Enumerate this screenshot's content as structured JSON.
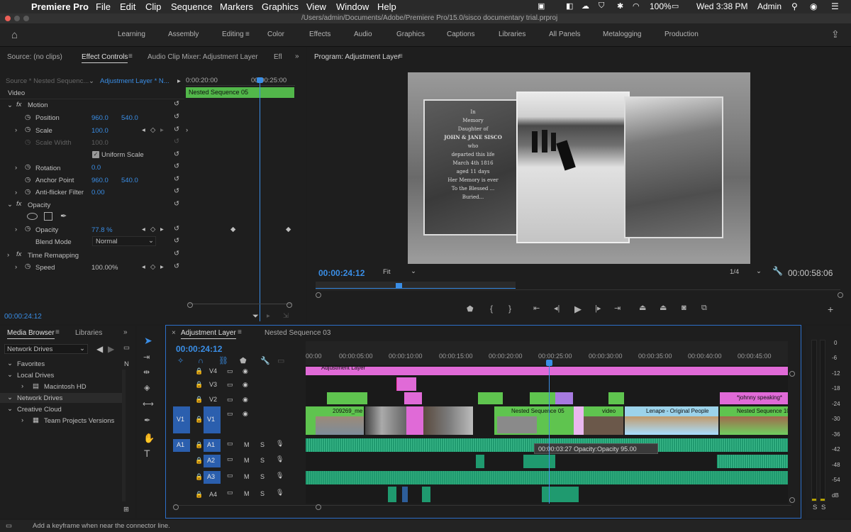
{
  "menubar": {
    "app": "Premiere Pro",
    "items": [
      "File",
      "Edit",
      "Clip",
      "Sequence",
      "Markers",
      "Graphics",
      "View",
      "Window",
      "Help"
    ],
    "battery": "100%",
    "datetime": "Wed 3:38 PM",
    "user": "Admin"
  },
  "window": {
    "title": "/Users/admin/Documents/Adobe/Premiere Pro/15.0/sisco documentary trial.prproj"
  },
  "workspaces": {
    "items": [
      "Learning",
      "Assembly",
      "Editing",
      "Color",
      "Effects",
      "Audio",
      "Graphics",
      "Captions",
      "Libraries",
      "All Panels",
      "Metalogging",
      "Production"
    ],
    "active": "Editing"
  },
  "source_panel": {
    "tabs": [
      "Source: (no clips)",
      "Effect Controls",
      "Audio Clip Mixer: Adjustment Layer",
      "Efl"
    ],
    "source_select": "Source * Nested Sequenc...",
    "target_select": "Adjustment Layer * N...",
    "ruler_start": "0:00:20:00",
    "ruler_end": "00:00:25:00",
    "clip_name": "Nested Sequence 05",
    "section_video": "Video",
    "timecode": "00:00:24:12",
    "motion": {
      "label": "Motion",
      "position_label": "Position",
      "position_x": "960.0",
      "position_y": "540.0",
      "scale_label": "Scale",
      "scale": "100.0",
      "scale_width_label": "Scale Width",
      "scale_width": "100.0",
      "uniform_label": "Uniform Scale",
      "rotation_label": "Rotation",
      "rotation": "0.0",
      "anchor_label": "Anchor Point",
      "anchor_x": "960.0",
      "anchor_y": "540.0",
      "antiflicker_label": "Anti-flicker Filter",
      "antiflicker": "0.00"
    },
    "opacity": {
      "label": "Opacity",
      "opacity_label": "Opacity",
      "opacity": "77.8 %",
      "blend_label": "Blend Mode",
      "blend": "Normal"
    },
    "time_remap": {
      "label": "Time Remapping",
      "speed_label": "Speed",
      "speed": "100.00%"
    }
  },
  "program": {
    "title": "Program: Adjustment Layer",
    "timecode": "00:00:24:12",
    "fit": "Fit",
    "resolution": "1/4",
    "duration": "00:00:58:06",
    "photo_text": [
      "In",
      "Memory",
      "Daughter of",
      "JOHN & JANE SISCO",
      "who",
      "departed this life",
      "March 4th 1816",
      "aged 11 days",
      "Her Memory is ever",
      "To the Blessed ...",
      "Buried..."
    ]
  },
  "project": {
    "tabs": [
      "Media Browser",
      "Libraries"
    ],
    "location": "Network Drives",
    "tree": [
      "Favorites",
      "Local Drives",
      "Macintosh HD",
      "Network Drives",
      "Creative Cloud",
      "Team Projects Versions"
    ]
  },
  "timeline": {
    "tabs": [
      "Adjustment Layer",
      "Nested Sequence 03"
    ],
    "timecode": "00:00:24:12",
    "ruler": [
      "00:00",
      "00:00:05:00",
      "00:00:10:00",
      "00:00:15:00",
      "00:00:20:00",
      "00:00:25:00",
      "00:00:30:00",
      "00:00:35:00",
      "00:00:40:00",
      "00:00:45:00"
    ],
    "tracks": {
      "video": [
        "V4",
        "V3",
        "V2",
        "V1"
      ],
      "audio": [
        "A1",
        "A2",
        "A3",
        "A4"
      ]
    },
    "clip_labels": {
      "adjustment": "Adjustment Layer",
      "johnny": "*johnny speaking*",
      "c209": "209269_me",
      "nested05": "Nested Sequence 05",
      "video": "video",
      "lenape": "Lenape - Original People",
      "nested10": "Nested Sequence 10"
    },
    "tooltip": "00:00:03:27  Opacity:Opacity  95.00"
  },
  "meter": {
    "scale": [
      "0",
      "-6",
      "-12",
      "-18",
      "-24",
      "-30",
      "-36",
      "-42",
      "-48",
      "-54",
      "dB"
    ],
    "solo": [
      "S",
      "S"
    ]
  },
  "status": "Add a keyframe when near the connector line.",
  "colors": {
    "accent": "#2e8ff0",
    "adjustment_clip": "#e06ad7",
    "video_clip": "#5fc44f",
    "audio_clip": "#1f9a6f"
  }
}
